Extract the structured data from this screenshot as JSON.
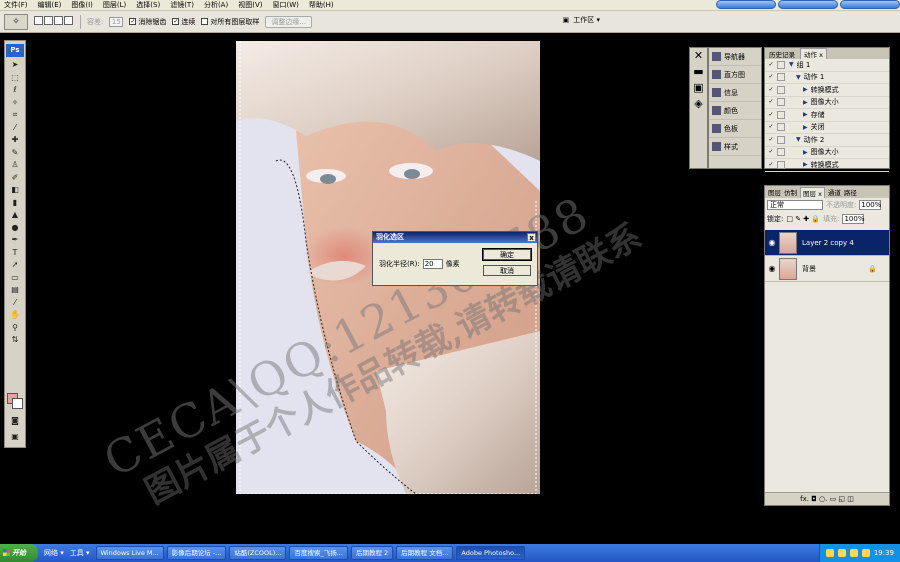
{
  "menu": [
    "文件(F)",
    "编辑(E)",
    "图像(I)",
    "图层(L)",
    "选择(S)",
    "滤镜(T)",
    "分析(A)",
    "视图(V)",
    "窗口(W)",
    "帮助(H)"
  ],
  "options": {
    "tolerance_label": "容差:",
    "tolerance_value": "15",
    "antialias": "消除锯齿",
    "contiguous": "连续",
    "sample_all": "对所有图层取样",
    "refine": "调整边缘...",
    "workspace": "工作区 ▾"
  },
  "toolbox": {
    "logo": "Ps"
  },
  "dialog": {
    "title": "羽化选区",
    "radius_label": "羽化半径(R):",
    "radius_value": "20",
    "unit": "像素",
    "ok": "确定",
    "cancel": "取消",
    "close": "x"
  },
  "watermark": {
    "line1": "CECA\\QQ:121301788",
    "line2": "图片属于个人作品转载,请转载请联系"
  },
  "nav_panel": {
    "items": [
      "导航器",
      "直方图",
      "信息",
      "颜色",
      "色板",
      "样式"
    ]
  },
  "actions_panel": {
    "tabs": [
      "历史记录",
      "动作 x"
    ],
    "rows": [
      {
        "indent": 1,
        "label": "组 1",
        "check": "✓"
      },
      {
        "indent": 2,
        "label": "动作 1",
        "check": "✓"
      },
      {
        "indent": 3,
        "label": "转换模式",
        "check": "✓"
      },
      {
        "indent": 3,
        "label": "图像大小",
        "check": "✓"
      },
      {
        "indent": 3,
        "label": "存储",
        "check": "✓"
      },
      {
        "indent": 3,
        "label": "关闭",
        "check": "✓"
      },
      {
        "indent": 2,
        "label": "动作 2",
        "check": "✓"
      },
      {
        "indent": 3,
        "label": "图像大小",
        "check": "✓"
      },
      {
        "indent": 3,
        "label": "转换模式",
        "check": "✓"
      }
    ]
  },
  "layers_panel": {
    "tabs": [
      "图层",
      "仿制",
      "图层 x",
      "通道",
      "路径"
    ],
    "blend_mode": "正常",
    "opacity_label": "不透明度:",
    "opacity_value": "100%",
    "lock_label": "锁定:",
    "fill_label": "填充:",
    "fill_value": "100%",
    "layers": [
      {
        "name": "Layer 2 copy 4",
        "active": true
      },
      {
        "name": "背景",
        "active": false,
        "locked": true
      }
    ],
    "footer": "fx. ◘ ○. ▭ ◱ ◫"
  },
  "taskbar": {
    "start": "开始",
    "quick": [
      "网络 ▾",
      "工具 ▾"
    ],
    "tasks": [
      "Windows Live M...",
      "影像后期论坛 -...",
      "站酷(ZCOOL)...",
      "百度搜索_飞扬...",
      "后期教程 2",
      "后期教程 文档...",
      "Adobe Photosho..."
    ],
    "active_task": 6,
    "clock": "19:39"
  }
}
